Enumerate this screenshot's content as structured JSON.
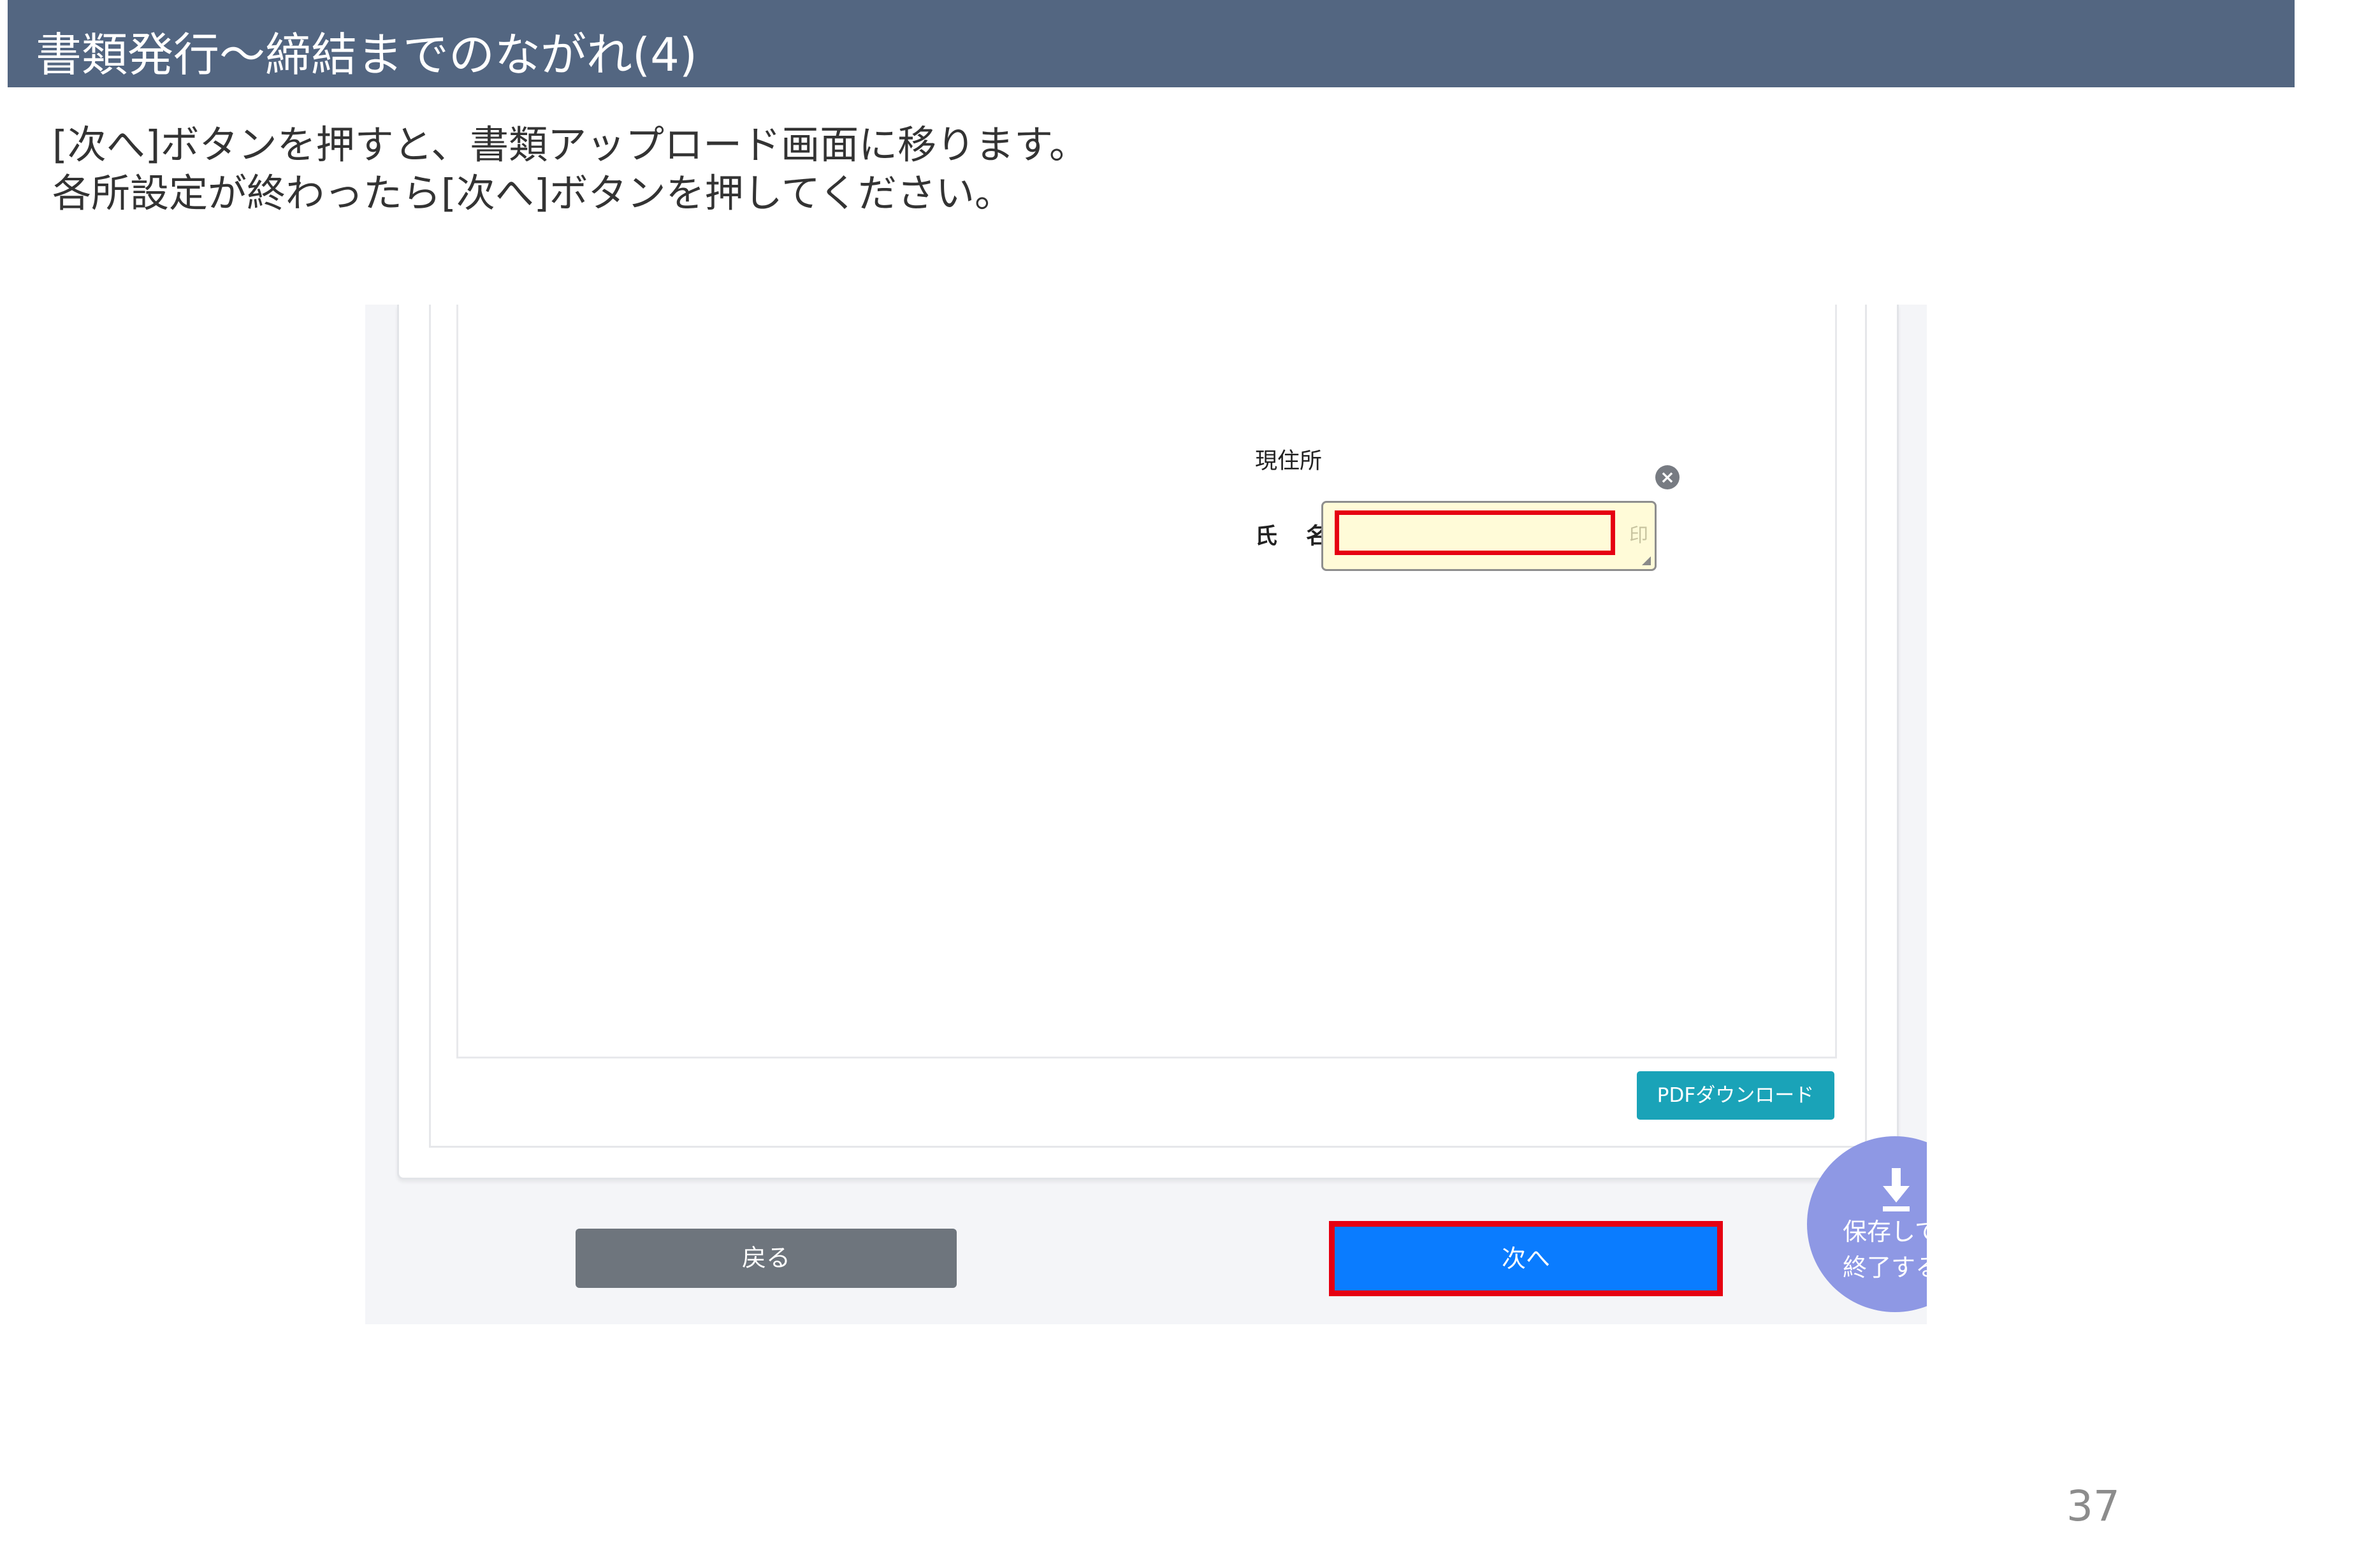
{
  "slide": {
    "title": "書類発行～締結までのながれ(4)",
    "instructions": [
      "[次へ]ボタンを押すと、書類アップロード画面に移ります。",
      "各所設定が終わったら[次へ]ボタンを押してください。"
    ],
    "page_number": "37"
  },
  "document": {
    "address_label": "現住所",
    "name_label_1": "氏",
    "name_label_2": "名",
    "seal_label": "印"
  },
  "buttons": {
    "pdf_download": "PDFダウンロード",
    "back": "戻る",
    "next": "次へ",
    "save_exit_line1": "保存して",
    "save_exit_line2": "終了する"
  },
  "colors": {
    "header_bg": "#536681",
    "next_button": "#0a7cff",
    "highlight_border": "#e60012",
    "pdf_button": "#1aa3b8",
    "back_button": "#6e757d",
    "fab": "#8e98e4"
  },
  "icons": {
    "close": "close-circle-icon",
    "download": "download-arrow-icon"
  }
}
